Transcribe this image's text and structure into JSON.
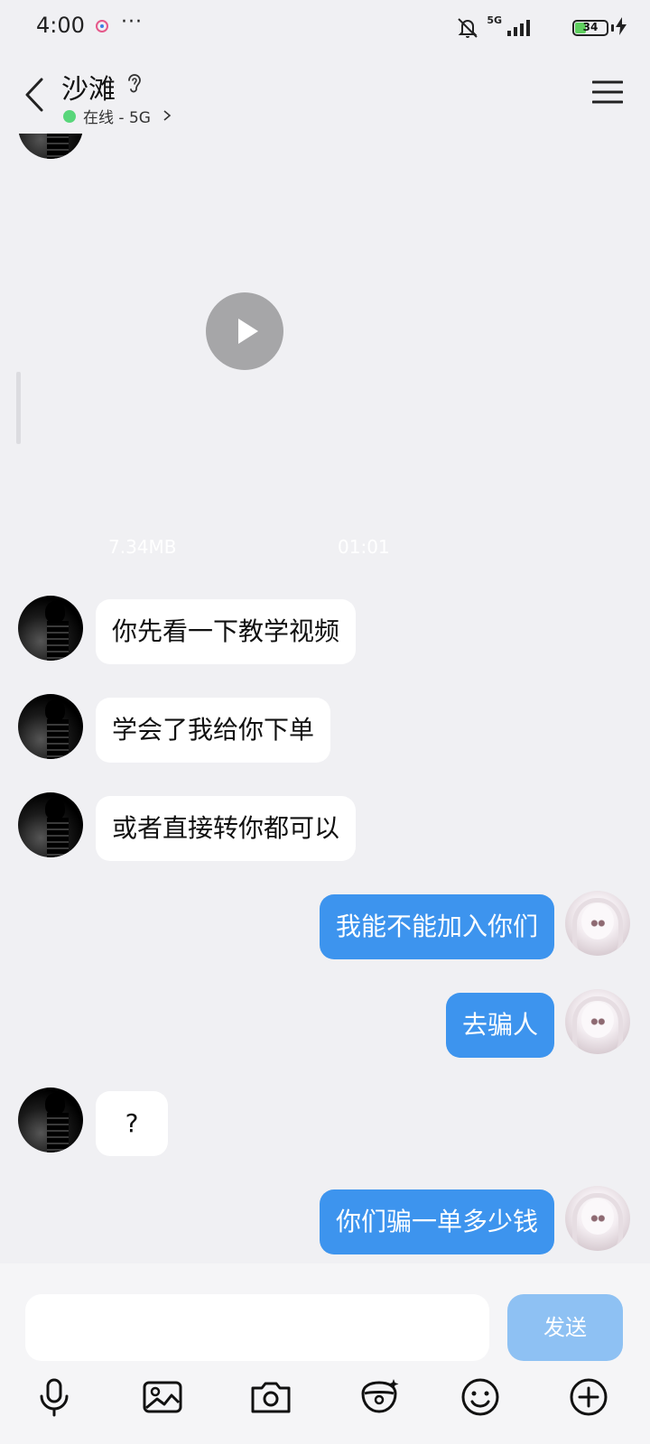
{
  "status_bar": {
    "time": "4:00",
    "dots": "···",
    "network": "5G",
    "battery": "34",
    "battery_level": 0.34
  },
  "header": {
    "contact_name": "沙滩",
    "online_status": "在线 - 5G",
    "online_color": "#58d67a"
  },
  "video_message": {
    "file_size": "7.34MB",
    "duration": "01:01"
  },
  "messages": [
    {
      "side": "incoming",
      "text": "你先看一下教学视频"
    },
    {
      "side": "incoming",
      "text": "学会了我给你下单"
    },
    {
      "side": "incoming",
      "text": "或者直接转你都可以"
    },
    {
      "side": "outgoing",
      "text": "我能不能加入你们"
    },
    {
      "side": "outgoing",
      "text": "去骗人"
    },
    {
      "side": "incoming",
      "text": "?"
    },
    {
      "side": "outgoing",
      "text": "你们骗一单多少钱"
    }
  ],
  "input_bar": {
    "placeholder": "",
    "send_label": "发送",
    "send_color": "#8ec1f3"
  },
  "toolbar": {
    "icons": [
      "microphone-icon",
      "image-icon",
      "camera-icon",
      "red-packet-icon",
      "emoji-icon",
      "plus-icon"
    ]
  },
  "colors": {
    "outgoing_bubble": "#3d94ee",
    "incoming_bubble": "#ffffff",
    "background": "#f0f0f3"
  }
}
